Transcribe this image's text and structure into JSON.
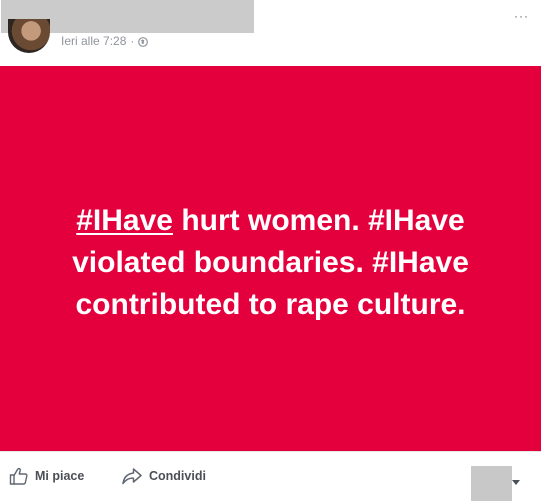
{
  "post": {
    "timestamp": "Ieri alle 7:28",
    "separator": "·",
    "privacy_icon": "globe-icon",
    "more_icon": "more-options-icon",
    "more_label": "···"
  },
  "card": {
    "background_color": "#e3003c",
    "text_color": "#ffffff",
    "hashtag": "#IHave",
    "text_rest": " hurt women. #IHave violated boundaries. #IHave contributed to rape culture."
  },
  "actions": {
    "like_label": "Mi piace",
    "like_icon": "thumbs-up-icon",
    "share_label": "Condividi",
    "share_icon": "share-arrow-icon",
    "reactions_dropdown_icon": "chevron-down-icon"
  }
}
